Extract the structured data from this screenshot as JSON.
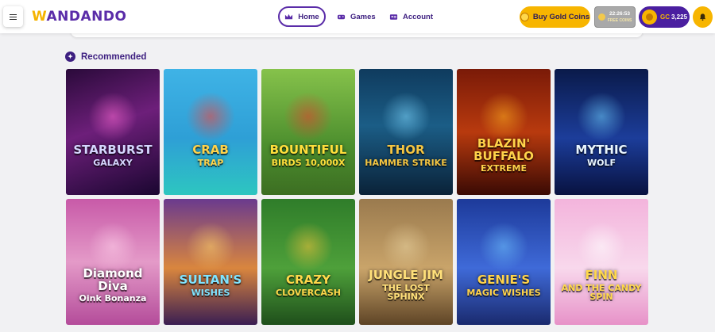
{
  "header": {
    "logo": {
      "prefix": "W",
      "rest": "ANDANDO"
    },
    "nav": [
      {
        "label": "Home",
        "icon": "crown-icon"
      },
      {
        "label": "Games",
        "icon": "gamepad-icon"
      },
      {
        "label": "Account",
        "icon": "id-card-icon"
      }
    ],
    "buy_label": "Buy Gold Coins",
    "timer": {
      "time": "22:26:53",
      "sub": "FREE COINS"
    },
    "balance": {
      "currency": "GC",
      "amount": "3,225"
    }
  },
  "section": {
    "title": "Recommended"
  },
  "games": [
    {
      "line1": "STARBURST",
      "line2": "GALAXY",
      "bg": "linear-gradient(160deg,#2a0a3a 0%,#6d1f7a 45%,#1a0630 100%)",
      "accent": "#ff6ad5",
      "title_color": "#d6d6ff"
    },
    {
      "line1": "CRAB",
      "line2": "TRAP",
      "bg": "linear-gradient(180deg,#3fb3e6 0%,#2e9fd6 55%,#2dc6c0 100%)",
      "accent": "#ff3b30",
      "title_color": "#ffd34a"
    },
    {
      "line1": "BOUNTIFUL",
      "line2": "BIRDS 10,000X",
      "bg": "linear-gradient(180deg,#86c24b 0%,#4d8f2e 60%,#3c6e22 100%)",
      "accent": "#e63b2e",
      "title_color": "#ffdf3b"
    },
    {
      "line1": "THOR",
      "line2": "HAMMER STRIKE",
      "bg": "linear-gradient(180deg,#0f3b5e 0%,#1b5d86 45%,#0a2238 100%)",
      "accent": "#7fd8ff",
      "title_color": "#f4c542"
    },
    {
      "line1": "BLAZIN' BUFFALO",
      "line2": "EXTREME",
      "bg": "linear-gradient(180deg,#7a1a08 0%,#b83a0e 50%,#3a0a04 100%)",
      "accent": "#ffb020",
      "title_color": "#ffd34a"
    },
    {
      "line1": "MYTHIC",
      "line2": "WOLF",
      "bg": "linear-gradient(180deg,#0a1a4a 0%,#1c3d9a 55%,#081240 100%)",
      "accent": "#6fd0ff",
      "title_color": "#e9f6ff"
    },
    {
      "line1": "Diamond Diva",
      "line2": "Oink Bonanza",
      "bg": "linear-gradient(180deg,#c85aa8 0%,#e49ac8 50%,#b44c9a 100%)",
      "accent": "#ffd1ea",
      "title_color": "#ffffff"
    },
    {
      "line1": "SULTAN'S",
      "line2": "WISHES",
      "bg": "linear-gradient(180deg,#6a3a8e 0%,#d9863e 55%,#3a1e52 100%)",
      "accent": "#ffd36b",
      "title_color": "#7fe3ff"
    },
    {
      "line1": "CRAZY",
      "line2": "CLOVERCASH",
      "bg": "linear-gradient(180deg,#2f7d2a 0%,#4ea03a 55%,#1f4f1b 100%)",
      "accent": "#f6c33b",
      "title_color": "#ffd84a"
    },
    {
      "line1": "JUNGLE JIM",
      "line2": "THE LOST SPHINX",
      "bg": "linear-gradient(180deg,#9a7a4e 0%,#c9a46a 55%,#5e4426 100%)",
      "accent": "#e8d2a0",
      "title_color": "#ffe07a"
    },
    {
      "line1": "GENIE'S",
      "line2": "MAGIC WISHES",
      "bg": "linear-gradient(180deg,#1d3a9a 0%,#3f6ad8 55%,#1a2a6e 100%)",
      "accent": "#6fc4ff",
      "title_color": "#ffd34a"
    },
    {
      "line1": "FINN",
      "line2": "AND THE CANDY SPIN",
      "bg": "linear-gradient(180deg,#f3b4dc 0%,#f8d8ec 55%,#e792c8 100%)",
      "accent": "#ffffff",
      "title_color": "#ffd84a"
    }
  ]
}
